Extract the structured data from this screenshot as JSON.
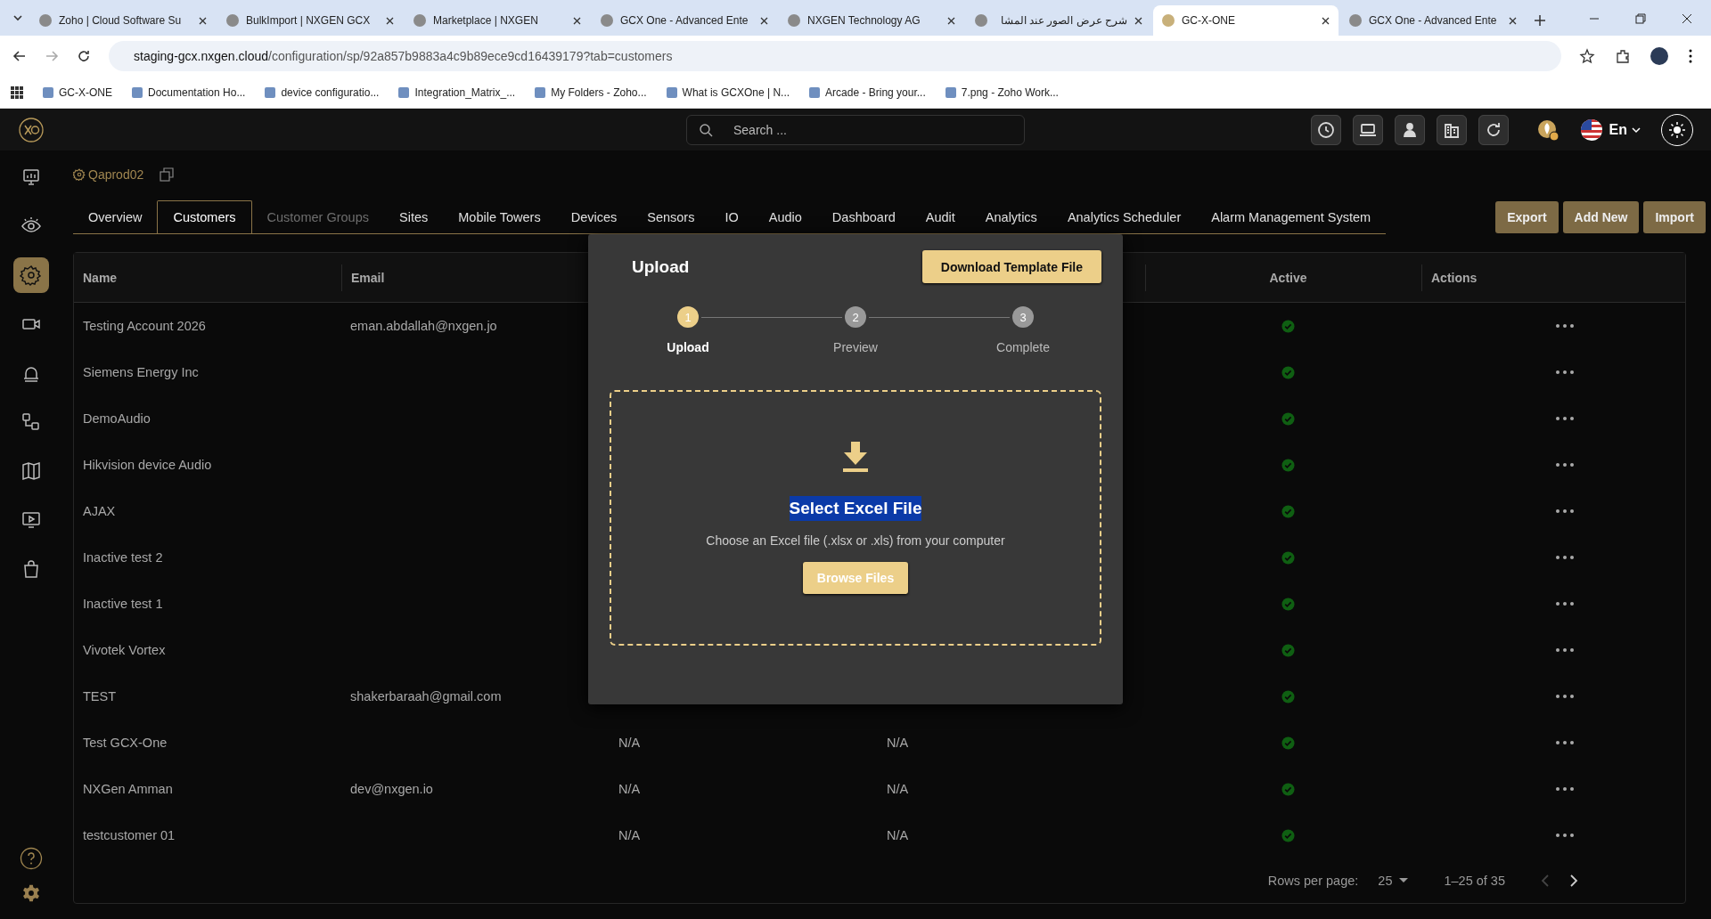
{
  "browser": {
    "tabs": [
      {
        "title": "Zoho | Cloud Software Su",
        "selected": false
      },
      {
        "title": "BulkImport | NXGEN GCX",
        "selected": false
      },
      {
        "title": "Marketplace | NXGEN",
        "selected": false
      },
      {
        "title": "GCX One - Advanced Ente",
        "selected": false
      },
      {
        "title": "NXGEN Technology AG",
        "selected": false
      },
      {
        "title": "شرح عرض الصور عند المشا",
        "selected": false
      },
      {
        "title": "GC-X-ONE",
        "selected": true
      },
      {
        "title": "GCX One - Advanced Ente",
        "selected": false
      }
    ],
    "url_host": "staging-gcx.nxgen.cloud",
    "url_path": "/configuration/sp/92a857b9883a4c9b89ece9cd16439179?tab=customers",
    "bookmarks": [
      "GC-X-ONE",
      "Documentation Ho...",
      "device configuratio...",
      "Integration_Matrix_...",
      "My Folders - Zoho...",
      "What is GCXOne | N...",
      "Arcade - Bring your...",
      "7.png - Zoho Work..."
    ]
  },
  "header": {
    "search": {
      "placeholder": "Search ..."
    },
    "language": "En"
  },
  "sidebar": {
    "items": [
      {
        "selected": false
      },
      {
        "selected": false
      },
      {
        "selected": true
      },
      {
        "selected": false
      },
      {
        "selected": false
      },
      {
        "selected": false
      },
      {
        "selected": false
      },
      {
        "selected": false
      },
      {
        "selected": false
      }
    ]
  },
  "project": {
    "name": "Qaprod02"
  },
  "tabs": [
    {
      "label": "Overview",
      "selected": false,
      "disabled": false
    },
    {
      "label": "Customers",
      "selected": true,
      "disabled": false
    },
    {
      "label": "Customer Groups",
      "selected": false,
      "disabled": true
    },
    {
      "label": "Sites",
      "selected": false,
      "disabled": false
    },
    {
      "label": "Mobile Towers",
      "selected": false,
      "disabled": false
    },
    {
      "label": "Devices",
      "selected": false,
      "disabled": false
    },
    {
      "label": "Sensors",
      "selected": false,
      "disabled": false
    },
    {
      "label": "IO",
      "selected": false,
      "disabled": false
    },
    {
      "label": "Audio",
      "selected": false,
      "disabled": false
    },
    {
      "label": "Dashboard",
      "selected": false,
      "disabled": false
    },
    {
      "label": "Audit",
      "selected": false,
      "disabled": false
    },
    {
      "label": "Analytics",
      "selected": false,
      "disabled": false
    },
    {
      "label": "Analytics Scheduler",
      "selected": false,
      "disabled": false
    },
    {
      "label": "Alarm Management System",
      "selected": false,
      "disabled": false
    }
  ],
  "actions": [
    "Export",
    "Add New",
    "Import"
  ],
  "table": {
    "columns": [
      "Name",
      "Email",
      "",
      "",
      "Active",
      "Actions"
    ],
    "rows": [
      {
        "name": "Testing Account 2026",
        "email": "eman.abdallah@nxgen.jo",
        "column_3": "",
        "column_4": "",
        "active": true
      },
      {
        "name": "Siemens Energy Inc",
        "email": "",
        "column_3": "",
        "column_4": "",
        "active": true
      },
      {
        "name": "DemoAudio",
        "email": "",
        "column_3": "",
        "column_4": "",
        "active": true
      },
      {
        "name": "Hikvision device Audio",
        "email": "",
        "column_3": "",
        "column_4": "",
        "active": true
      },
      {
        "name": "AJAX",
        "email": "",
        "column_3": "",
        "column_4": "",
        "active": true
      },
      {
        "name": "Inactive test 2",
        "email": "",
        "column_3": "",
        "column_4": "",
        "active": true
      },
      {
        "name": "Inactive test 1",
        "email": "",
        "column_3": "",
        "column_4": "",
        "active": true
      },
      {
        "name": "Vivotek Vortex",
        "email": "",
        "column_3": "",
        "column_4": "",
        "active": true
      },
      {
        "name": "TEST",
        "email": "shakerbaraah@gmail.com",
        "column_3": "",
        "column_4": "",
        "active": true
      },
      {
        "name": "Test GCX-One",
        "email": "",
        "column_3": "N/A",
        "column_4": "N/A",
        "active": true
      },
      {
        "name": "NXGen Amman",
        "email": "dev@nxgen.io",
        "column_3": "N/A",
        "column_4": "N/A",
        "active": true
      },
      {
        "name": "testcustomer 01",
        "email": "",
        "column_3": "N/A",
        "column_4": "N/A",
        "active": true
      }
    ],
    "pagination": {
      "rows_per_page_label": "Rows per page:",
      "rows_per_page": "25",
      "range": "1–25 of 35"
    }
  },
  "modal": {
    "title": "Upload",
    "download_button": "Download Template File",
    "steps": [
      {
        "number": "1",
        "label": "Upload",
        "selected": true
      },
      {
        "number": "2",
        "label": "Preview",
        "selected": false
      },
      {
        "number": "3",
        "label": "Complete",
        "selected": false
      }
    ],
    "dropzone": {
      "title": "Select Excel File",
      "highlighted": true,
      "description": "Choose an Excel file (.xlsx or .xls) from your computer",
      "button": "Browse Files"
    }
  }
}
